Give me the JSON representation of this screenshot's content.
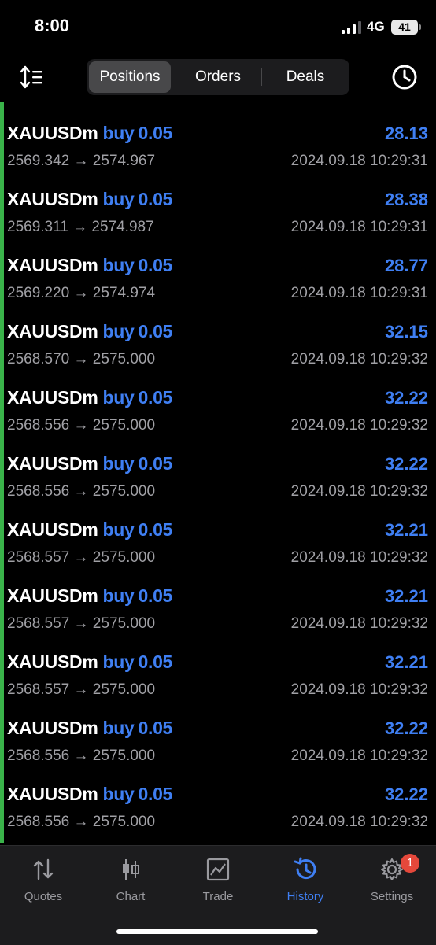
{
  "status_bar": {
    "time": "8:00",
    "network": "4G",
    "battery": "41"
  },
  "tabs": [
    {
      "label": "Positions",
      "active": true
    },
    {
      "label": "Orders",
      "active": false
    },
    {
      "label": "Deals",
      "active": false
    }
  ],
  "rows": [
    {
      "symbol": "XAUUSDm",
      "side": "buy",
      "volume": "0.05",
      "profit": "28.13",
      "prices": "2569.342 → 2574.967",
      "datetime": "2024.09.18 10:29:31"
    },
    {
      "symbol": "XAUUSDm",
      "side": "buy",
      "volume": "0.05",
      "profit": "28.38",
      "prices": "2569.311 → 2574.987",
      "datetime": "2024.09.18 10:29:31"
    },
    {
      "symbol": "XAUUSDm",
      "side": "buy",
      "volume": "0.05",
      "profit": "28.77",
      "prices": "2569.220 → 2574.974",
      "datetime": "2024.09.18 10:29:31"
    },
    {
      "symbol": "XAUUSDm",
      "side": "buy",
      "volume": "0.05",
      "profit": "32.15",
      "prices": "2568.570 → 2575.000",
      "datetime": "2024.09.18 10:29:32"
    },
    {
      "symbol": "XAUUSDm",
      "side": "buy",
      "volume": "0.05",
      "profit": "32.22",
      "prices": "2568.556 → 2575.000",
      "datetime": "2024.09.18 10:29:32"
    },
    {
      "symbol": "XAUUSDm",
      "side": "buy",
      "volume": "0.05",
      "profit": "32.22",
      "prices": "2568.556 → 2575.000",
      "datetime": "2024.09.18 10:29:32"
    },
    {
      "symbol": "XAUUSDm",
      "side": "buy",
      "volume": "0.05",
      "profit": "32.21",
      "prices": "2568.557 → 2575.000",
      "datetime": "2024.09.18 10:29:32"
    },
    {
      "symbol": "XAUUSDm",
      "side": "buy",
      "volume": "0.05",
      "profit": "32.21",
      "prices": "2568.557 → 2575.000",
      "datetime": "2024.09.18 10:29:32"
    },
    {
      "symbol": "XAUUSDm",
      "side": "buy",
      "volume": "0.05",
      "profit": "32.21",
      "prices": "2568.557 → 2575.000",
      "datetime": "2024.09.18 10:29:32"
    },
    {
      "symbol": "XAUUSDm",
      "side": "buy",
      "volume": "0.05",
      "profit": "32.22",
      "prices": "2568.556 → 2575.000",
      "datetime": "2024.09.18 10:29:32"
    },
    {
      "symbol": "XAUUSDm",
      "side": "buy",
      "volume": "0.05",
      "profit": "32.22",
      "prices": "2568.556 → 2575.000",
      "datetime": "2024.09.18 10:29:32"
    }
  ],
  "bottom_nav": [
    {
      "label": "Quotes",
      "icon": "quotes-icon"
    },
    {
      "label": "Chart",
      "icon": "chart-icon"
    },
    {
      "label": "Trade",
      "icon": "trade-icon"
    },
    {
      "label": "History",
      "icon": "history-icon",
      "active": true
    },
    {
      "label": "Settings",
      "icon": "gear-icon",
      "badge": "1"
    }
  ],
  "colors": {
    "accent": "#3f7ff3",
    "position_bar": "#3ab34a",
    "badge": "#e5483b",
    "muted_text": "#a0a0a5"
  }
}
